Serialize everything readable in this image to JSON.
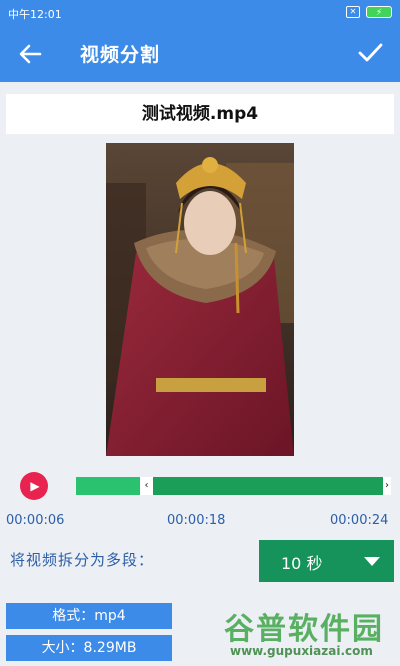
{
  "status_bar": {
    "time": "中午12:01",
    "sim_icon": "sim-icon",
    "battery_icon": "battery-charging-icon"
  },
  "app_bar": {
    "title": "视频分割",
    "back_icon": "back-arrow-icon",
    "confirm_icon": "check-icon"
  },
  "file": {
    "name": "测试视频.mp4"
  },
  "timeline": {
    "start_time": "00:00:06",
    "current_time": "00:00:18",
    "end_time": "00:00:24",
    "selected_start_fraction": 0.25,
    "selected_end_fraction": 1.0,
    "play_icon": "play-icon"
  },
  "split": {
    "label": "将视频拆分为多段：",
    "selected_value": "10 秒",
    "dropdown_icon": "chevron-down-icon"
  },
  "info": {
    "format": "格式：mp4",
    "size": "大小：8.29MB"
  },
  "watermark": {
    "text": "谷普软件园",
    "url": "www.gupuxiazai.com"
  },
  "colors": {
    "primary": "#3d8be8",
    "accent_green": "#15935a",
    "play_red": "#e8234f",
    "label_blue": "#2c5fa8"
  }
}
